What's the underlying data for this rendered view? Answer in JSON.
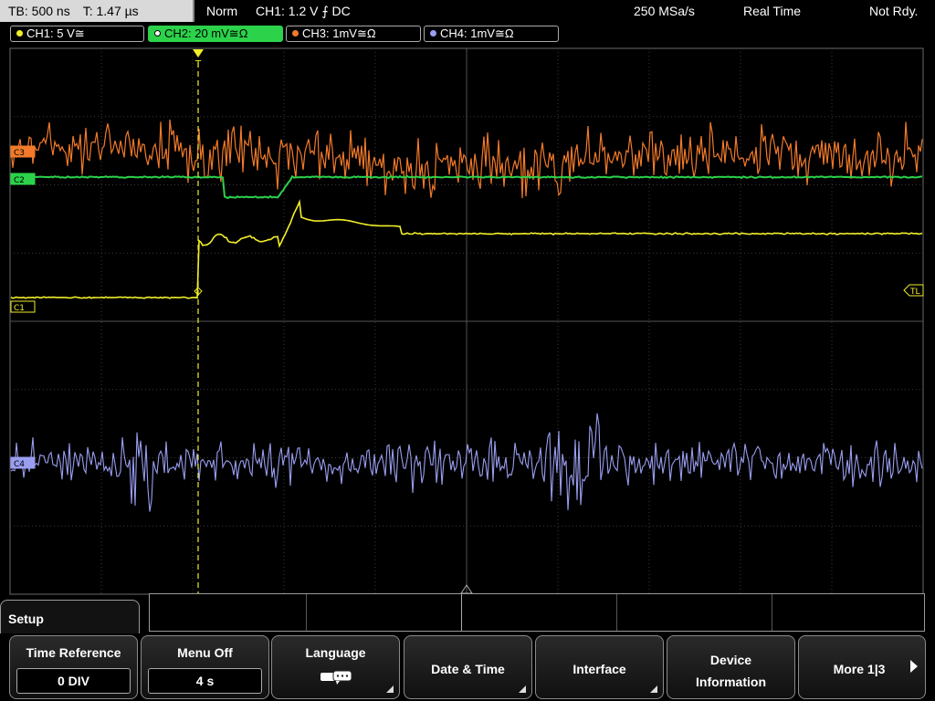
{
  "topbar": {
    "timebase": "TB: 500 ns",
    "trigger_time": "T: 1.47 µs",
    "mode": "Norm",
    "trigger_setting": "CH1: 1.2 V ⨍ DC",
    "sample_rate": "250 MSa/s",
    "acq_mode": "Real Time",
    "state": "Not Rdy."
  },
  "channels": [
    {
      "label": "CH1: 5 V≅",
      "color": "#f2ee2a",
      "active": false
    },
    {
      "label": "CH2: 20 mV≅Ω",
      "color": "#2bd24a",
      "active": true
    },
    {
      "label": "CH3: 1mV≅Ω",
      "color": "#f27a2a",
      "active": false
    },
    {
      "label": "CH4: 1mV≅Ω",
      "color": "#9a9ef0",
      "active": false
    }
  ],
  "markers": {
    "c1": "C1",
    "c2": "C2",
    "c3": "C3",
    "c4": "C4",
    "trigger_level": "TL",
    "trigger_pos": "T"
  },
  "menu": {
    "title": "Setup",
    "softkeys": {
      "time_reference": {
        "label": "Time Reference",
        "value": "0 DIV"
      },
      "menu_off": {
        "label": "Menu Off",
        "value": "4 s"
      },
      "language": {
        "label": "Language"
      },
      "date_time": {
        "label": "Date & Time"
      },
      "interface": {
        "label": "Interface"
      },
      "device_info": {
        "line1": "Device",
        "line2": "Information"
      },
      "more": {
        "label": "More 1|3"
      }
    }
  },
  "colors": {
    "ch1": "#f2ee2a",
    "ch2": "#2bd24a",
    "ch3": "#f27a2a",
    "ch4": "#9a9ef0",
    "grid": "#3a3a3a"
  }
}
